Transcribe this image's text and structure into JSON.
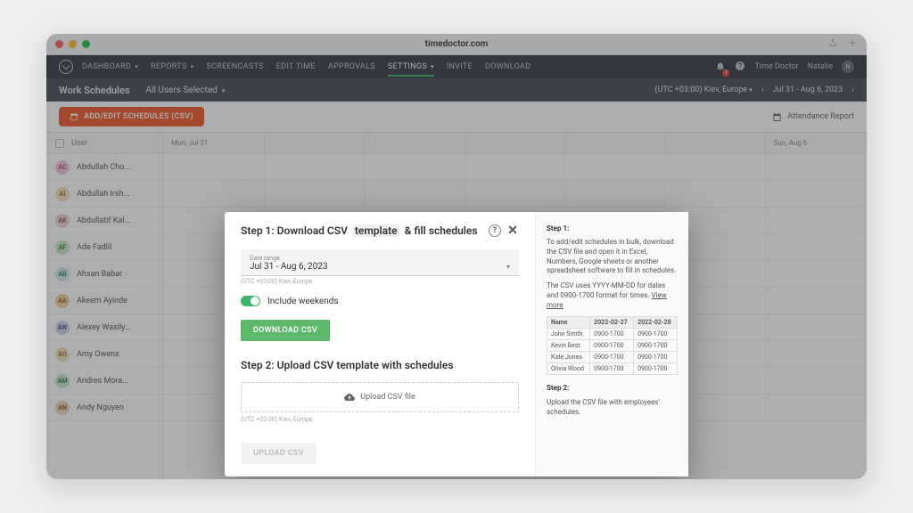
{
  "browser": {
    "url": "timedoctor.com"
  },
  "nav": {
    "items": [
      "DASHBOARD",
      "REPORTS",
      "SCREENCASTS",
      "EDIT TIME",
      "APPROVALS",
      "SETTINGS",
      "INVITE",
      "DOWNLOAD"
    ],
    "active": "SETTINGS",
    "bell_count": "1",
    "company": "Time Doctor",
    "user": "Natalie",
    "user_initial": "N"
  },
  "subheader": {
    "title": "Work Schedules",
    "filter": "All Users Selected",
    "timezone": "(UTC +03:00) Kiev, Europe",
    "range": "Jul 31 - Aug 6, 2023"
  },
  "actions": {
    "add_edit": "ADD/EDIT SCHEDULES (CSV)",
    "attendance": "Attendance Report"
  },
  "grid": {
    "user_header": "User",
    "columns": [
      "Mon, Jul 31",
      "",
      "",
      "",
      "",
      "",
      "Sun, Aug 6"
    ],
    "users": [
      {
        "initials": "AC",
        "name": "Abdullah Cho...",
        "bg": "#f4c7d8",
        "fg": "#9b4664"
      },
      {
        "initials": "AI",
        "name": "Abdullah Irsh...",
        "bg": "#f5e3b8",
        "fg": "#8a6b20"
      },
      {
        "initials": "AK",
        "name": "Abdullatif Kal...",
        "bg": "#f0d4d0",
        "fg": "#8a4d44"
      },
      {
        "initials": "AF",
        "name": "Ade Fadlil",
        "bg": "#c9e8c3",
        "fg": "#3e7a33"
      },
      {
        "initials": "AB",
        "name": "Ahsan Babar",
        "bg": "#cfe8e3",
        "fg": "#2f7a6c"
      },
      {
        "initials": "AA",
        "name": "Akeem Ayinde",
        "bg": "#f4d19a",
        "fg": "#8a5a10"
      },
      {
        "initials": "AW",
        "name": "Alexey Wasily...",
        "bg": "#d2d7ec",
        "fg": "#45508a"
      },
      {
        "initials": "AO",
        "name": "Amy Owens",
        "bg": "#f5e3b8",
        "fg": "#8a6b20"
      },
      {
        "initials": "AM",
        "name": "Andres Mora...",
        "bg": "#c7e6cd",
        "fg": "#2f7a44"
      },
      {
        "initials": "AN",
        "name": "Andy Nguyen",
        "bg": "#f3d7b6",
        "fg": "#8a5a24"
      }
    ]
  },
  "modal": {
    "step1_pre": "Step 1: Download CSV ",
    "step1_hl": "template",
    "step1_post": " & fill schedules",
    "date_label": "Date range",
    "date_value": "Jul 31 - Aug 6, 2023",
    "tz": "(UTC +03:00) Kiev, Europe",
    "include_weekends": "Include weekends",
    "download": "DOWNLOAD CSV",
    "step2_title": "Step 2: Upload CSV template with schedules",
    "drop_label": "Upload CSV file",
    "tz2": "(UTC +03:00) Kiev, Europe",
    "upload": "UPLOAD CSV"
  },
  "help": {
    "step1_h": "Step 1:",
    "step1_p1": "To add/edit schedules in bulk, download the CSV file and open it in Excel, Numbers, Google sheets or another spreadsheet software to fill in schedules.",
    "step1_p2_a": "The CSV uses YYYY-MM-DD for dates and 0900-1700 format for times. ",
    "step1_link": "View more",
    "table": {
      "headers": [
        "Name",
        "2022-02-27",
        "2022-02-28"
      ],
      "rows": [
        [
          "John Smith",
          "0900-1700",
          "0900-1700"
        ],
        [
          "Kevin Best",
          "0900-1700",
          "0900-1700"
        ],
        [
          "Kate Jones",
          "0900-1700",
          "0900-1700"
        ],
        [
          "Olivia Wood",
          "0900-1700",
          "0900-1700"
        ]
      ]
    },
    "step2_h": "Step 2:",
    "step2_p": "Upload the CSV file with employees' schedules."
  }
}
